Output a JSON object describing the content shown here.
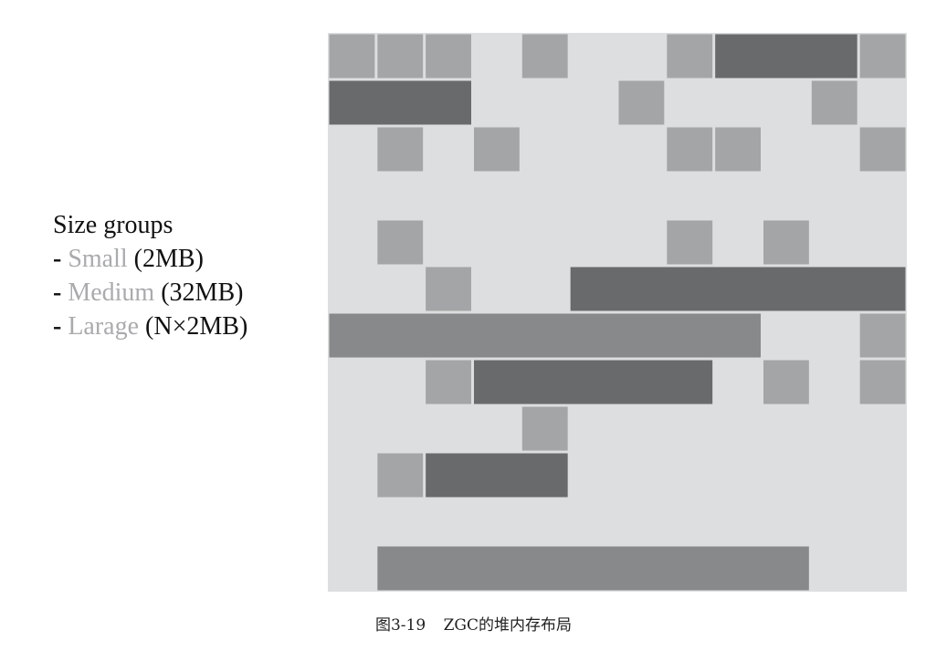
{
  "legend": {
    "heading": "Size groups",
    "items": [
      {
        "dash": "-",
        "name": "Small",
        "size": "(2MB)",
        "dash_bold": true
      },
      {
        "dash": "-",
        "name": "Medium",
        "size": "(32MB)",
        "dash_bold": true
      },
      {
        "dash": "-",
        "name": "Larage",
        "size": "(N×2MB)",
        "dash_bold": false
      }
    ]
  },
  "colors": {
    "background": "#dcdedf",
    "small": "#a4a5a6",
    "medium": "#686a6b",
    "large": "#87898a",
    "legend_text": "#111111",
    "legend_name": "#a9abac"
  },
  "heap": {
    "columns": 12,
    "rows": 12,
    "pages": [
      {
        "type": "small",
        "row": 0,
        "col": 0,
        "span": 1
      },
      {
        "type": "small",
        "row": 0,
        "col": 1,
        "span": 1
      },
      {
        "type": "small",
        "row": 0,
        "col": 2,
        "span": 1
      },
      {
        "type": "small",
        "row": 0,
        "col": 4,
        "span": 1
      },
      {
        "type": "small",
        "row": 0,
        "col": 7,
        "span": 1
      },
      {
        "type": "medium",
        "row": 0,
        "col": 8,
        "span": 3
      },
      {
        "type": "small",
        "row": 0,
        "col": 11,
        "span": 1
      },
      {
        "type": "medium",
        "row": 1,
        "col": 0,
        "span": 3
      },
      {
        "type": "small",
        "row": 1,
        "col": 6,
        "span": 1
      },
      {
        "type": "small",
        "row": 1,
        "col": 10,
        "span": 1
      },
      {
        "type": "small",
        "row": 2,
        "col": 1,
        "span": 1
      },
      {
        "type": "small",
        "row": 2,
        "col": 3,
        "span": 1
      },
      {
        "type": "small",
        "row": 2,
        "col": 7,
        "span": 1
      },
      {
        "type": "small",
        "row": 2,
        "col": 8,
        "span": 1
      },
      {
        "type": "small",
        "row": 2,
        "col": 11,
        "span": 1
      },
      {
        "type": "small",
        "row": 4,
        "col": 1,
        "span": 1
      },
      {
        "type": "small",
        "row": 4,
        "col": 7,
        "span": 1
      },
      {
        "type": "small",
        "row": 4,
        "col": 9,
        "span": 1
      },
      {
        "type": "small",
        "row": 5,
        "col": 2,
        "span": 1
      },
      {
        "type": "medium",
        "row": 5,
        "col": 5,
        "span": 7
      },
      {
        "type": "large",
        "row": 6,
        "col": 0,
        "span": 9
      },
      {
        "type": "small",
        "row": 6,
        "col": 11,
        "span": 1
      },
      {
        "type": "small",
        "row": 7,
        "col": 2,
        "span": 1
      },
      {
        "type": "medium",
        "row": 7,
        "col": 3,
        "span": 5
      },
      {
        "type": "small",
        "row": 7,
        "col": 9,
        "span": 1
      },
      {
        "type": "small",
        "row": 7,
        "col": 11,
        "span": 1
      },
      {
        "type": "small",
        "row": 8,
        "col": 4,
        "span": 1
      },
      {
        "type": "small",
        "row": 9,
        "col": 1,
        "span": 1
      },
      {
        "type": "medium",
        "row": 9,
        "col": 2,
        "span": 3
      },
      {
        "type": "large",
        "row": 11,
        "col": 1,
        "span": 9
      }
    ]
  },
  "caption": {
    "figure_number": "图3-19",
    "title": "ZGC的堆内存布局"
  }
}
